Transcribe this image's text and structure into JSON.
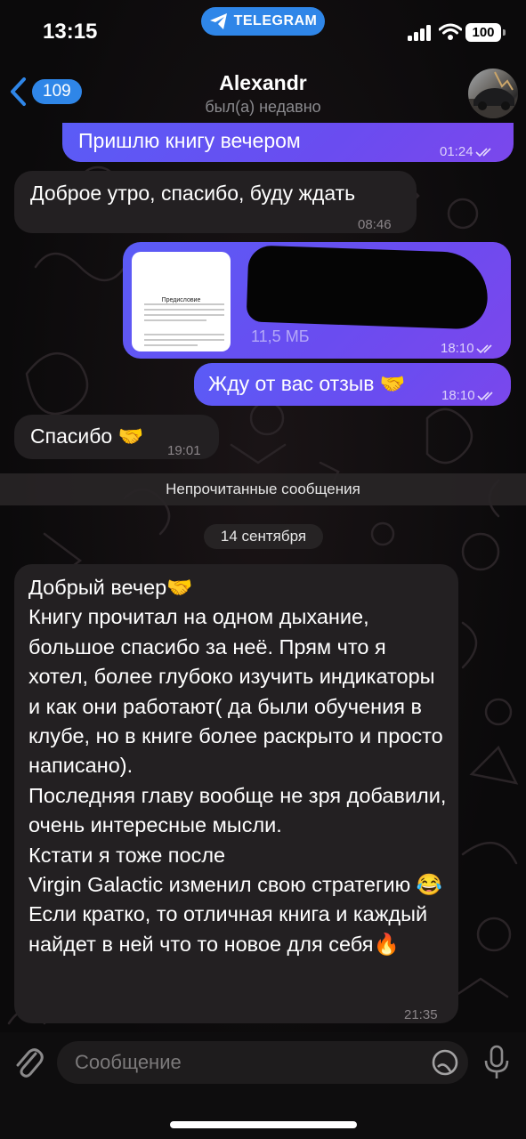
{
  "status_bar": {
    "time": "13:15",
    "app_pill": "TELEGRAM",
    "battery": "100"
  },
  "header": {
    "back_count": "109",
    "name": "Alexandr",
    "status": "был(а) недавно"
  },
  "messages": [
    {
      "dir": "out",
      "text": "Пришлю книгу вечером",
      "time": "01:24"
    },
    {
      "dir": "in",
      "text": "Доброе утро, спасибо, буду ждать",
      "time": "08:46"
    },
    {
      "dir": "out",
      "type": "document",
      "thumb_title": "Предисловие",
      "size": "11,5 МБ",
      "time": "18:10"
    },
    {
      "dir": "out",
      "text": "Жду от вас отзыв 🤝",
      "time": "18:10"
    },
    {
      "dir": "in",
      "text": "Спасибо 🤝",
      "time": "19:01"
    }
  ],
  "unread_label": "Непрочитанные сообщения",
  "date_label": "14 сентября",
  "long_message": {
    "text": "Добрый вечер🤝\nКнигу прочитал на одном дыхание, большое спасибо за неё. Прям что я хотел, более глубоко изучить индикаторы и как они работают( да были обучения в клубе, но в книге более раскрыто и просто написано).\nПоследняя главу вообще не зря добавили, очень интересные мысли.\nКстати я тоже после\nVirgin Galactic изменил свою стратегию 😂\nЕсли кратко, то отличная книга и каждый найдет в ней что то новое для себя🔥",
    "time": "21:35"
  },
  "input": {
    "placeholder": "Сообщение"
  },
  "colors": {
    "accent": "#2f86e8",
    "outgoing": "#5a5cf6",
    "incoming": "#232022"
  }
}
